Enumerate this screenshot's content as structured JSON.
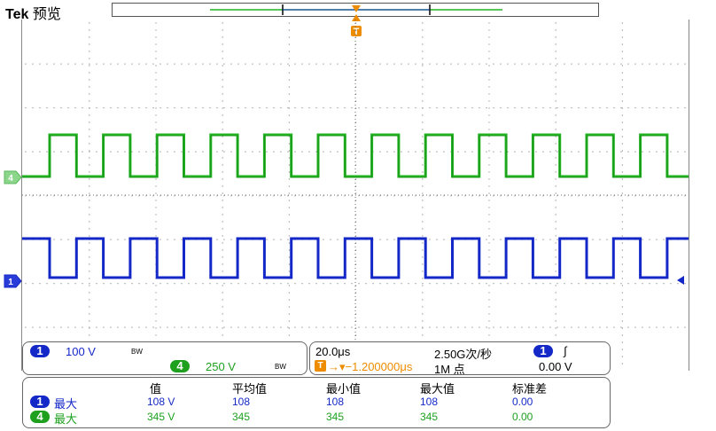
{
  "header": {
    "brand": "Tek",
    "mode": "预览"
  },
  "trigger_marker": {
    "label": "T"
  },
  "channels": {
    "ch4": {
      "marker": "4",
      "color": "#22b422"
    },
    "ch1": {
      "marker": "1",
      "color": "#1428c8"
    }
  },
  "vertical_panel": {
    "ch1_badge": "1",
    "ch1_scale": "100 V",
    "ch1_bw": "BW",
    "ch4_badge": "4",
    "ch4_scale": "250 V",
    "ch4_bw": "BW"
  },
  "horizontal_panel": {
    "timebase": "20.0μs",
    "sample_rate": "2.50G次/秒",
    "trigger_source_badge": "1",
    "trigger_slope": "∫",
    "trigger_position_icon": "T",
    "trigger_position": "→▾−1.200000μs",
    "record_length": "1M 点",
    "trigger_level": "0.00 V"
  },
  "measurements": {
    "headers": [
      "值",
      "平均值",
      "最小值",
      "最大值",
      "标准差"
    ],
    "rows": [
      {
        "badge": "1",
        "label": "最大",
        "value": "108 V",
        "mean": "108",
        "min": "108",
        "max": "108",
        "std": "0.00",
        "color": "#1428c8"
      },
      {
        "badge": "4",
        "label": "最大",
        "value": "345 V",
        "mean": "345",
        "min": "345",
        "max": "345",
        "std": "0.00",
        "color": "#1ea01e"
      }
    ]
  },
  "colors": {
    "grid_dots": "#9a9a9a",
    "ch1_trace": "#1428c8",
    "ch4_trace": "#22b422",
    "trigger": "#ee8c00"
  }
}
